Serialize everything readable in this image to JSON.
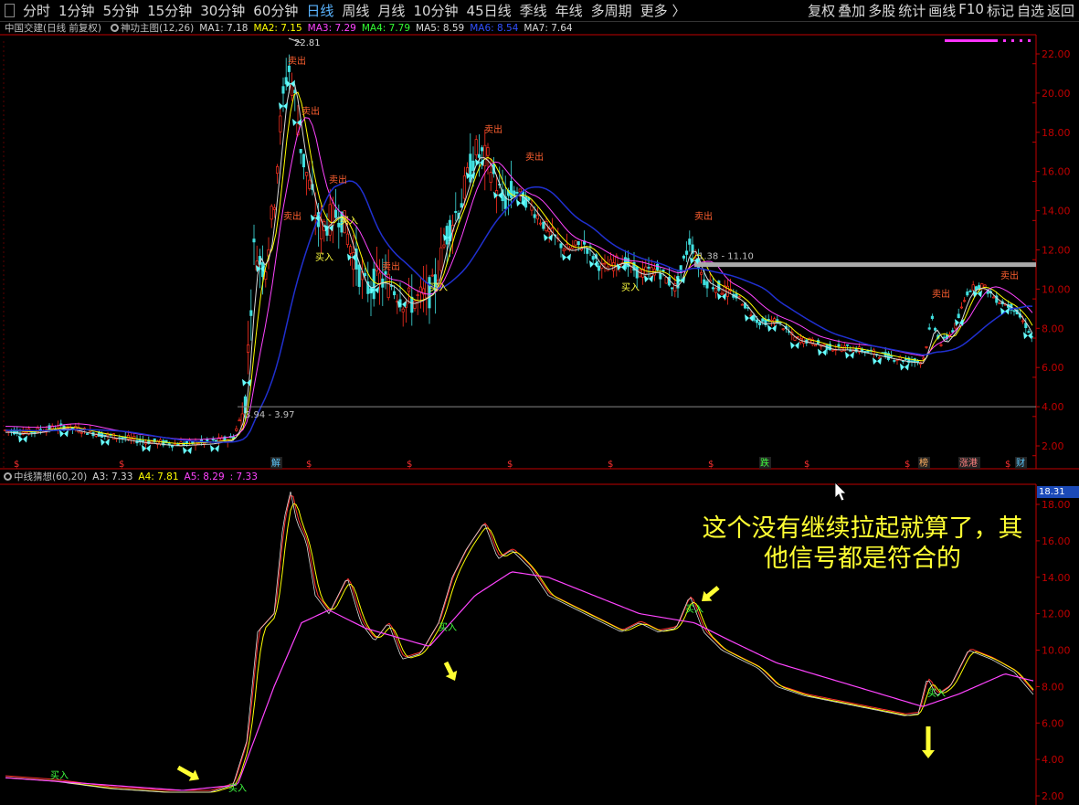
{
  "toolbar": {
    "items": [
      "分时",
      "1分钟",
      "5分钟",
      "15分钟",
      "30分钟",
      "60分钟",
      "日线",
      "周线",
      "月线",
      "10分钟",
      "45日线",
      "季线",
      "年线",
      "多周期",
      "更多 〉"
    ],
    "active": "日线",
    "right_items": [
      "复权",
      "叠加",
      "多股",
      "统计",
      "画线",
      "F10",
      "标记",
      "自选",
      "返回"
    ]
  },
  "main_panel": {
    "title": "中国交建(日线 前复权)",
    "indicator": "神功主图(12,26)",
    "ma": [
      {
        "label": "MA1: 7.18",
        "color": "#d8d8d8"
      },
      {
        "label": "MA2: 7.15",
        "color": "#ffff00"
      },
      {
        "label": "MA3: 7.29",
        "color": "#ff44ff"
      },
      {
        "label": "MA4: 7.79",
        "color": "#33ff33"
      },
      {
        "label": "MA5: 8.59",
        "color": "#d8d8d8"
      },
      {
        "label": "MA6: 8.54",
        "color": "#3050ff"
      },
      {
        "label": "MA7: 7.64",
        "color": "#d8d8d8"
      }
    ],
    "y_ticks": [
      "22.00",
      "20.00",
      "18.00",
      "16.00",
      "14.00",
      "12.00",
      "10.00",
      "8.00",
      "6.00",
      "4.00",
      "2.00"
    ],
    "high_label": "22.81",
    "range_label_top": "1.38 - 11.10",
    "range_label_bottom": "3.94 - 3.97",
    "event_markers": [
      "解",
      "跌",
      "榜",
      "涨港",
      "财"
    ],
    "buy_label": "买入",
    "sell_label": "卖出"
  },
  "sub_panel": {
    "indicator": "中线猜想(60,20)",
    "values": [
      {
        "label": "A3: 7.33",
        "color": "#d8d8d8"
      },
      {
        "label": "A4: 7.81",
        "color": "#ffff00"
      },
      {
        "label": "A5: 8.29",
        "color": "#ff44ff"
      },
      {
        "label": ": 7.33",
        "color": "#ff44ff"
      }
    ],
    "y_ticks": [
      "18.00",
      "16.00",
      "14.00",
      "12.00",
      "10.00",
      "8.00",
      "6.00",
      "4.00",
      "2.00"
    ],
    "current_price": "18.31",
    "buy_label": "买入",
    "annotation": "这个没有继续拉起就算了，其他信号都是符合的"
  },
  "colors": {
    "axis_red": "#c00000",
    "grid_red": "#5a0000",
    "candle_red": "#ff3020",
    "candle_cyan": "#40e0e0",
    "ma_blue": "#2030d0",
    "annotation_yellow": "#ffff33",
    "butterfly_cyan": "#66ffff"
  },
  "icons": [
    "gear-icon",
    "butterfly-icon",
    "arrow-icon",
    "cursor-icon"
  ]
}
